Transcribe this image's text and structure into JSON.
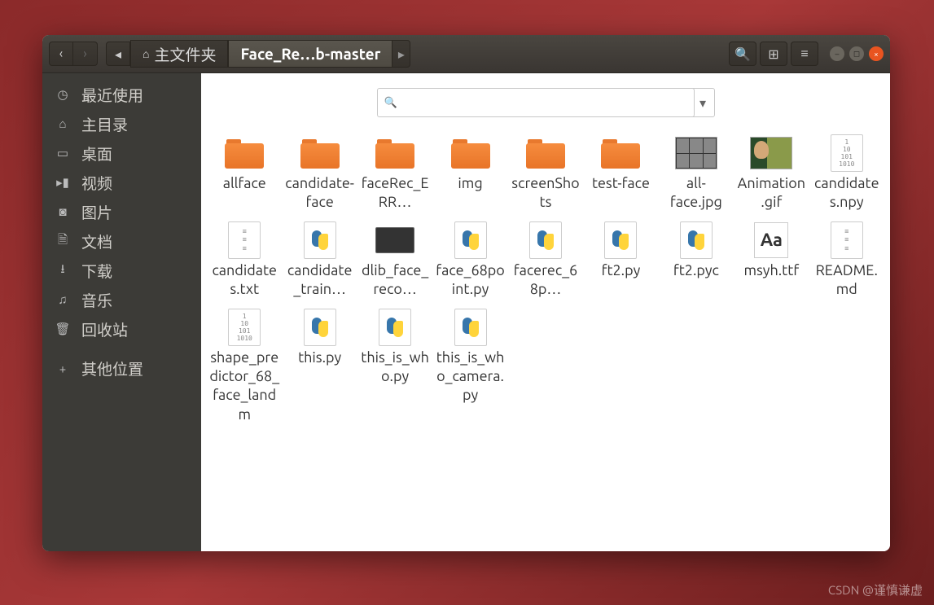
{
  "breadcrumb": {
    "home": "主文件夹",
    "current": "Face_Re…b-master"
  },
  "search": {
    "placeholder": ""
  },
  "sidebar": {
    "items": [
      {
        "icon": "clock",
        "label": "最近使用"
      },
      {
        "icon": "home",
        "label": "主目录"
      },
      {
        "icon": "desktop",
        "label": "桌面"
      },
      {
        "icon": "video",
        "label": "视频"
      },
      {
        "icon": "image",
        "label": "图片"
      },
      {
        "icon": "document",
        "label": "文档"
      },
      {
        "icon": "download",
        "label": "下载"
      },
      {
        "icon": "music",
        "label": "音乐"
      },
      {
        "icon": "trash",
        "label": "回收站"
      }
    ],
    "other": {
      "icon": "plus",
      "label": "其他位置"
    }
  },
  "files": [
    {
      "type": "folder",
      "name": "allface"
    },
    {
      "type": "folder",
      "name": "candidate-face"
    },
    {
      "type": "folder",
      "name": "faceRec_ERR…"
    },
    {
      "type": "folder",
      "name": "img"
    },
    {
      "type": "folder",
      "name": "screenShots"
    },
    {
      "type": "folder",
      "name": "test-face"
    },
    {
      "type": "image",
      "name": "all-face.jpg"
    },
    {
      "type": "gif",
      "name": "Animation.gif"
    },
    {
      "type": "bin",
      "name": "candidates.npy"
    },
    {
      "type": "txt",
      "name": "candidates.txt"
    },
    {
      "type": "py",
      "name": "candidate_train…"
    },
    {
      "type": "dat",
      "name": "dlib_face_reco…"
    },
    {
      "type": "py",
      "name": "face_68point.py"
    },
    {
      "type": "py",
      "name": "facerec_68p…"
    },
    {
      "type": "py",
      "name": "ft2.py"
    },
    {
      "type": "py",
      "name": "ft2.pyc"
    },
    {
      "type": "font",
      "name": "msyh.ttf"
    },
    {
      "type": "txt",
      "name": "README.md"
    },
    {
      "type": "bin",
      "name": "shape_predictor_68_face_landm"
    },
    {
      "type": "py",
      "name": "this.py"
    },
    {
      "type": "py",
      "name": "this_is_who.py"
    },
    {
      "type": "py",
      "name": "this_is_who_camera.py"
    }
  ],
  "watermark": "CSDN @谨慎谦虚",
  "icons": {
    "clock": "◷",
    "home": "⌂",
    "desktop": "▭",
    "video": "▸▮",
    "image": "◙",
    "document": "🗎",
    "download": "⭳",
    "music": "♫",
    "trash": "🗑",
    "plus": "+",
    "back": "‹",
    "forward": "›",
    "search": "🔍",
    "grid": "⊞",
    "menu": "≡"
  }
}
